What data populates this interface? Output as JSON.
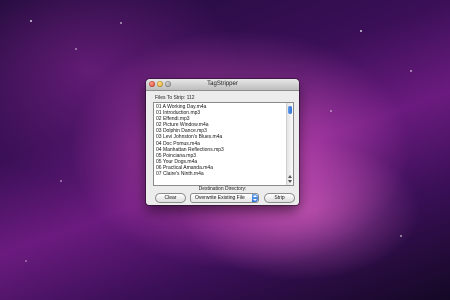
{
  "window": {
    "title": "TagStripper",
    "files_label": "Files To Strip: 112",
    "files": [
      "01 A Working Day.m4a",
      "01 Introduction.mp3",
      "02 Effendi.mp3",
      "02 Picture Window.m4a",
      "03 Dolphin Dance.mp3",
      "03 Levi Johnston's Blues.m4a",
      "04 Doc Pomus.m4a",
      "04 Manhattan Reflections.mp3",
      "05 Poinciana.mp3",
      "05 Your Dogs.m4a",
      "06 Practical Amanda.m4a",
      "07 Claire's Ninth.m4a"
    ],
    "destination_label": "Destination Directory:",
    "clear_label": "Clear",
    "mode_selected": "Overwrite Existing File",
    "strip_label": "Strip"
  },
  "colors": {
    "accent_blue": "#2f6fd6",
    "desktop_purple": "#6b1b7f"
  }
}
